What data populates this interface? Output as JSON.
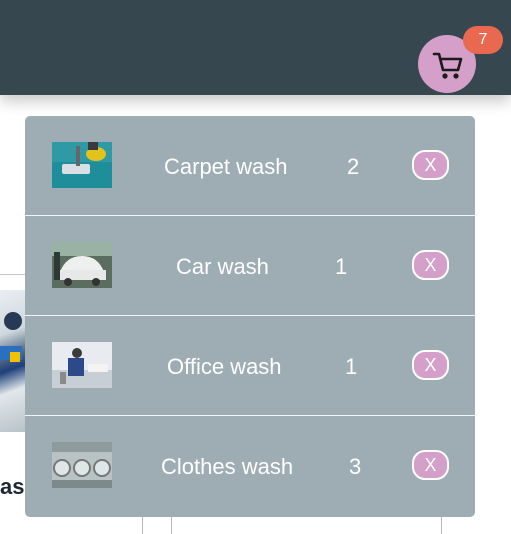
{
  "cart": {
    "badge_count": "7",
    "icon": "cart-icon",
    "remove_label": "X",
    "items": [
      {
        "name": "Carpet wash",
        "qty": "2",
        "thumb": "carpet-wash-thumbnail"
      },
      {
        "name": "Car wash",
        "qty": "1",
        "thumb": "car-wash-thumbnail"
      },
      {
        "name": "Office wash",
        "qty": "1",
        "thumb": "office-wash-thumbnail"
      },
      {
        "name": "Clothes wash",
        "qty": "3",
        "thumb": "clothes-wash-thumbnail"
      }
    ]
  },
  "background": {
    "partial_title": "as"
  },
  "colors": {
    "header": "#37474f",
    "cart_button": "#d49fc9",
    "badge": "#e8694f",
    "dropdown": "#9eadb4"
  }
}
